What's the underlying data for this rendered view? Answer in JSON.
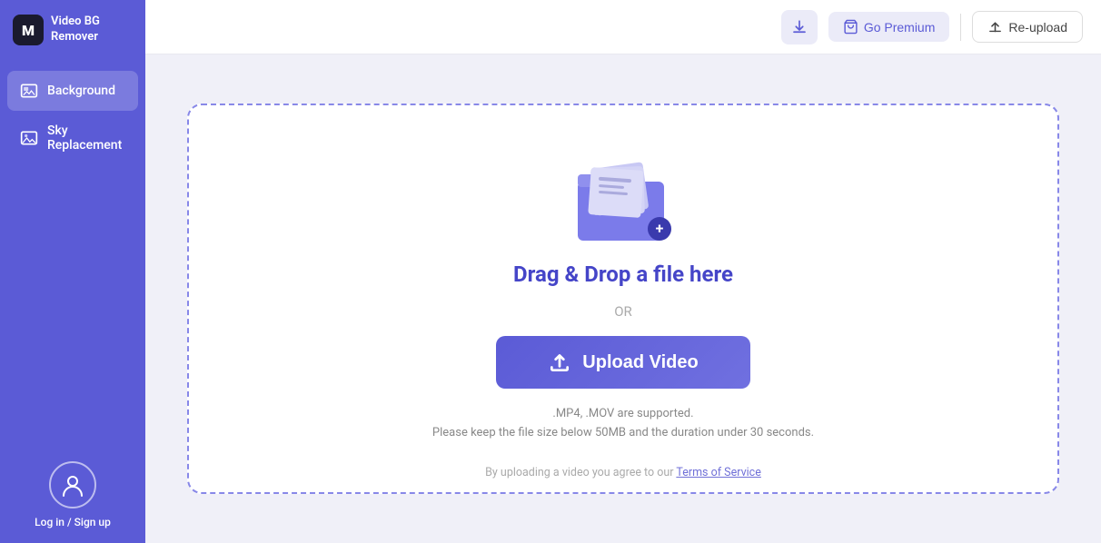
{
  "app": {
    "logo_letter": "M",
    "logo_name": "Video BG",
    "logo_subtitle": "Remover"
  },
  "sidebar": {
    "items": [
      {
        "id": "background",
        "label": "Background",
        "active": true
      },
      {
        "id": "sky-replacement",
        "label": "Sky Replacement",
        "active": false
      }
    ]
  },
  "header": {
    "download_tooltip": "Download",
    "premium_label": "Go Premium",
    "reupload_label": "Re-upload"
  },
  "upload": {
    "drag_title": "Drag & Drop a file here",
    "or_text": "OR",
    "button_label": "Upload Video",
    "file_info_line1": ".MP4, .MOV are supported.",
    "file_info_line2": "Please keep the file size below 50MB and the duration under 30 seconds.",
    "terms_prefix": "By uploading a video you agree to our ",
    "terms_link": "Terms of Service"
  },
  "user": {
    "login_label": "Log in / Sign up"
  }
}
